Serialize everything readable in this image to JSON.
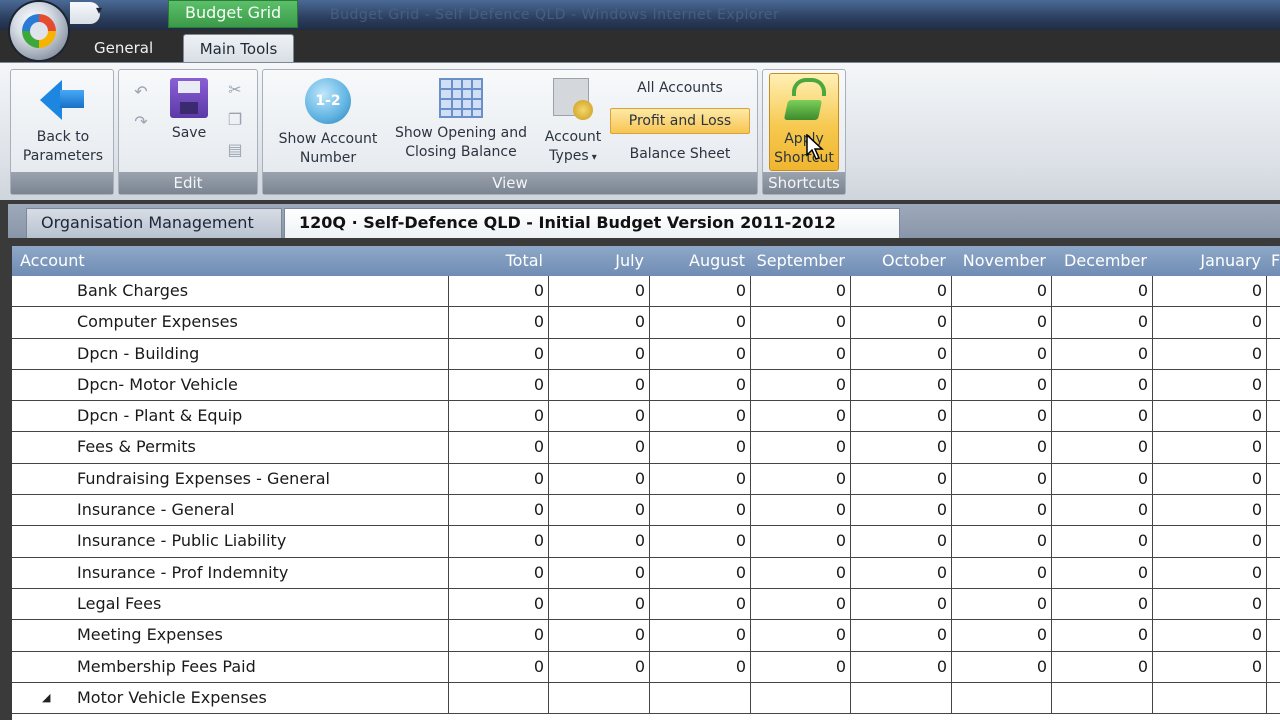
{
  "window": {
    "context_tab_group": "Budget Grid",
    "blurred_title": "Budget Grid - Self Defence QLD - Windows Internet Explorer"
  },
  "ribbon_tabs": [
    {
      "label": "General",
      "active": false
    },
    {
      "label": "Main Tools",
      "active": true
    }
  ],
  "ribbon": {
    "back_label": "Back to\nParameters",
    "save_label": "Save",
    "edit_group": "Edit",
    "show_account_number": "Show Account\nNumber",
    "account_number_icon": "1-2",
    "show_opening_closing": "Show Opening and\nClosing Balance",
    "account_types": "Account\nTypes",
    "view_options": [
      "All Accounts",
      "Profit and Loss",
      "Balance Sheet"
    ],
    "view_selected": "Profit and Loss",
    "view_group": "View",
    "apply_shortcut": "Apply\nShortcut",
    "shortcuts_group": "Shortcuts"
  },
  "doc_tabs": [
    {
      "label": "Organisation Management",
      "active": false
    },
    {
      "label": "120Q · Self-Defence QLD - Initial Budget Version 2011-2012",
      "active": true
    }
  ],
  "grid": {
    "columns": [
      "Account",
      "Total",
      "July",
      "August",
      "September",
      "October",
      "November",
      "December",
      "January",
      "F"
    ],
    "rows": [
      {
        "name": "Bank Charges",
        "values": [
          "0",
          "0",
          "0",
          "0",
          "0",
          "0",
          "0",
          "0"
        ]
      },
      {
        "name": "Computer Expenses",
        "values": [
          "0",
          "0",
          "0",
          "0",
          "0",
          "0",
          "0",
          "0"
        ]
      },
      {
        "name": "Dpcn - Building",
        "values": [
          "0",
          "0",
          "0",
          "0",
          "0",
          "0",
          "0",
          "0"
        ]
      },
      {
        "name": "Dpcn- Motor Vehicle",
        "values": [
          "0",
          "0",
          "0",
          "0",
          "0",
          "0",
          "0",
          "0"
        ]
      },
      {
        "name": "Dpcn - Plant & Equip",
        "values": [
          "0",
          "0",
          "0",
          "0",
          "0",
          "0",
          "0",
          "0"
        ]
      },
      {
        "name": "Fees & Permits",
        "values": [
          "0",
          "0",
          "0",
          "0",
          "0",
          "0",
          "0",
          "0"
        ]
      },
      {
        "name": "Fundraising Expenses - General",
        "values": [
          "0",
          "0",
          "0",
          "0",
          "0",
          "0",
          "0",
          "0"
        ]
      },
      {
        "name": "Insurance - General",
        "values": [
          "0",
          "0",
          "0",
          "0",
          "0",
          "0",
          "0",
          "0"
        ]
      },
      {
        "name": "Insurance - Public Liability",
        "values": [
          "0",
          "0",
          "0",
          "0",
          "0",
          "0",
          "0",
          "0"
        ]
      },
      {
        "name": "Insurance - Prof Indemnity",
        "values": [
          "0",
          "0",
          "0",
          "0",
          "0",
          "0",
          "0",
          "0"
        ]
      },
      {
        "name": "Legal Fees",
        "values": [
          "0",
          "0",
          "0",
          "0",
          "0",
          "0",
          "0",
          "0"
        ]
      },
      {
        "name": "Meeting Expenses",
        "values": [
          "0",
          "0",
          "0",
          "0",
          "0",
          "0",
          "0",
          "0"
        ]
      },
      {
        "name": "Membership Fees Paid",
        "values": [
          "0",
          "0",
          "0",
          "0",
          "0",
          "0",
          "0",
          "0"
        ]
      },
      {
        "name": "Motor Vehicle Expenses",
        "values": [
          "",
          "",
          "",
          "",
          "",
          "",
          "",
          ""
        ],
        "expandable": true
      }
    ]
  },
  "colors": {
    "grid_header": "#7f9abd",
    "highlight": "#f7c552",
    "context_tab": "#4caf5a"
  }
}
